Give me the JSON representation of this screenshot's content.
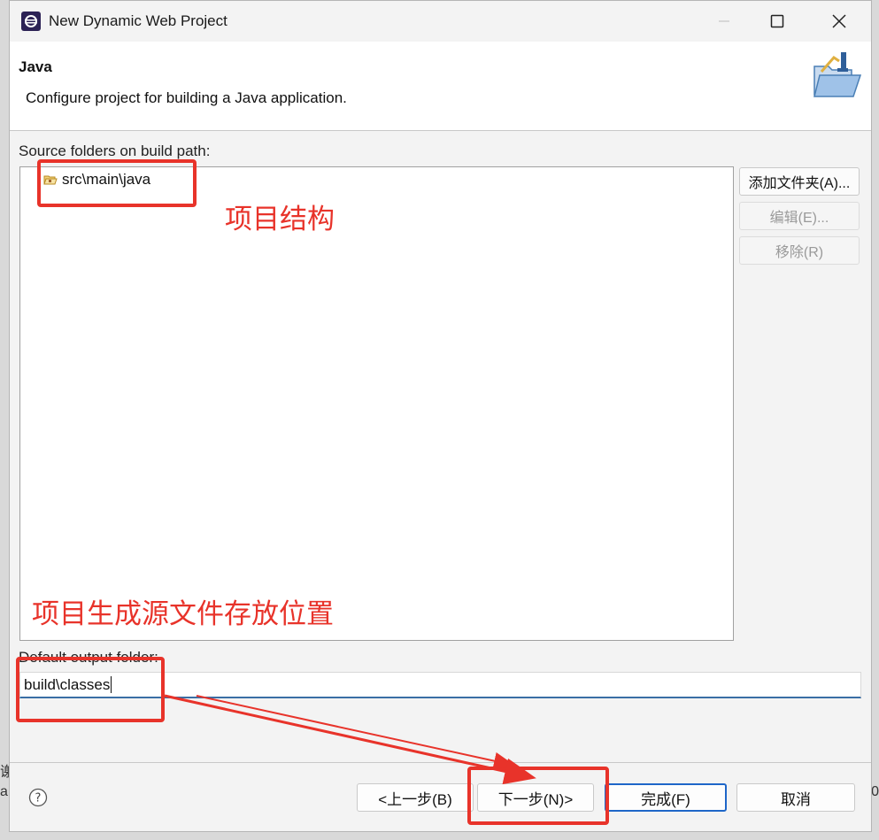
{
  "background": {
    "left_frag_1": "谢",
    "left_frag_2": "a",
    "right_frag": "0"
  },
  "window": {
    "title": "New Dynamic Web Project"
  },
  "header": {
    "title": "Java",
    "description": "Configure project for building a Java application."
  },
  "source_folders": {
    "label": "Source folders on build path:",
    "items": [
      {
        "label": "src\\main\\java",
        "icon": "package-folder-icon"
      }
    ]
  },
  "side_buttons": {
    "add_folder": "添加文件夹(A)...",
    "edit": "编辑(E)...",
    "remove": "移除(R)"
  },
  "output": {
    "label": "Default output folder:",
    "value": "build\\classes"
  },
  "footer": {
    "back": "<上一步(B)",
    "next": "下一步(N)>",
    "finish": "完成(F)",
    "cancel": "取消"
  },
  "annotations": {
    "structure": "项目结构",
    "output_location": "项目生成源文件存放位置",
    "color": "#e8332a"
  }
}
